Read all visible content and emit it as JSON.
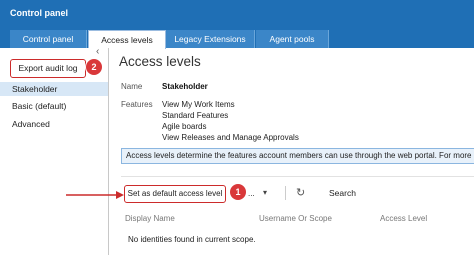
{
  "app": {
    "title": "Control panel"
  },
  "tabs": [
    {
      "label": "Control panel"
    },
    {
      "label": "Access levels"
    },
    {
      "label": "Legacy Extensions"
    },
    {
      "label": "Agent pools"
    }
  ],
  "sidebar": {
    "export_label": "Export audit log",
    "items": [
      {
        "label": "Stakeholder"
      },
      {
        "label": "Basic (default)"
      },
      {
        "label": "Advanced"
      }
    ]
  },
  "main": {
    "heading": "Access levels",
    "name_label": "Name",
    "name_value": "Stakeholder",
    "features_label": "Features",
    "features": [
      "View My Work Items",
      "Standard Features",
      "Agile boards",
      "View Releases and Manage Approvals"
    ],
    "info": "Access levels determine the features account members can use through the web portal. For more"
  },
  "toolbar": {
    "default_label": "Set as default access level",
    "add_label": "Add...",
    "search_label": "Search"
  },
  "table": {
    "columns": [
      "Display Name",
      "Username Or Scope",
      "Access Level"
    ],
    "empty_text": "No identities found in current scope."
  },
  "callouts": {
    "one": "1",
    "two": "2"
  },
  "colors": {
    "header": "#1f6fb5",
    "callout": "#d9383a",
    "highlight": "#cc2b2b"
  },
  "icons": [
    "chevron-left-icon",
    "refresh-icon",
    "chevron-down-icon"
  ]
}
